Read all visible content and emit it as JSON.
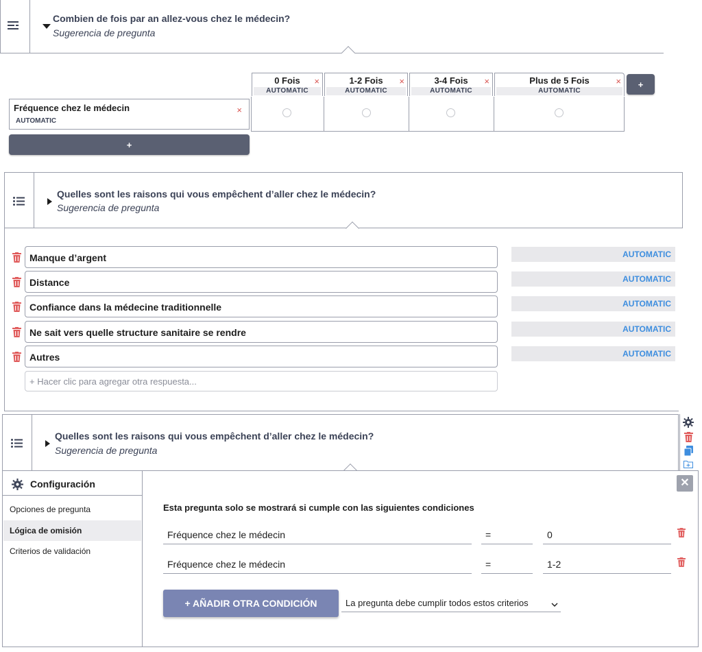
{
  "q1": {
    "title": "Combien de fois par an allez-vous chez le médecin?",
    "hint": "Sugerencia de pregunta",
    "columns": [
      {
        "label": "0 Fois",
        "badge": "AUTOMATIC"
      },
      {
        "label": "1-2 Fois",
        "badge": "AUTOMATIC"
      },
      {
        "label": "3-4 Fois",
        "badge": "AUTOMATIC"
      },
      {
        "label": "Plus de 5 Fois",
        "badge": "AUTOMATIC"
      }
    ],
    "row": {
      "label": "Fréquence chez le médecin",
      "badge": "AUTOMATIC"
    },
    "add_column_label": "+",
    "add_row_label": "+",
    "remove_symbol": "×"
  },
  "q2": {
    "title": "Quelles sont les raisons qui vous empêchent d’aller chez le médecin?",
    "hint": "Sugerencia de pregunta",
    "answers": [
      {
        "text": "Manque d’argent",
        "badge": "AUTOMATIC"
      },
      {
        "text": "Distance",
        "badge": "AUTOMATIC"
      },
      {
        "text": "Confiance dans la médecine traditionnelle",
        "badge": "AUTOMATIC"
      },
      {
        "text": "Ne sait vers quelle structure sanitaire se rendre",
        "badge": "AUTOMATIC"
      },
      {
        "text": "Autres",
        "badge": "AUTOMATIC"
      }
    ],
    "add_placeholder": "+ Hacer clic para agregar otra respuesta..."
  },
  "q3": {
    "title": "Quelles sont les raisons qui vous empêchent d’aller chez le médecin?",
    "hint": "Sugerencia de pregunta"
  },
  "settings": {
    "title": "Configuración",
    "menu": [
      "Opciones de pregunta",
      "Lógica de omisión",
      "Criterios de validación"
    ],
    "active_index": 1,
    "heading": "Esta pregunta solo se mostrará si cumple con las siguientes condiciones",
    "conditions": [
      {
        "question": "Fréquence chez le médecin",
        "operator": "=",
        "value": "0"
      },
      {
        "question": "Fréquence chez le médecin",
        "operator": "=",
        "value": "1-2"
      }
    ],
    "add_condition_label": "+ AÑADIR OTRA CONDICIÓN",
    "match_select": "La pregunta debe cumplir todos estos criterios",
    "close_symbol": "✕"
  },
  "colors": {
    "accent_blue": "#3e8edf",
    "danger": "#e05a5a",
    "button": "#7a85b3",
    "dark_button": "#5a6072"
  }
}
